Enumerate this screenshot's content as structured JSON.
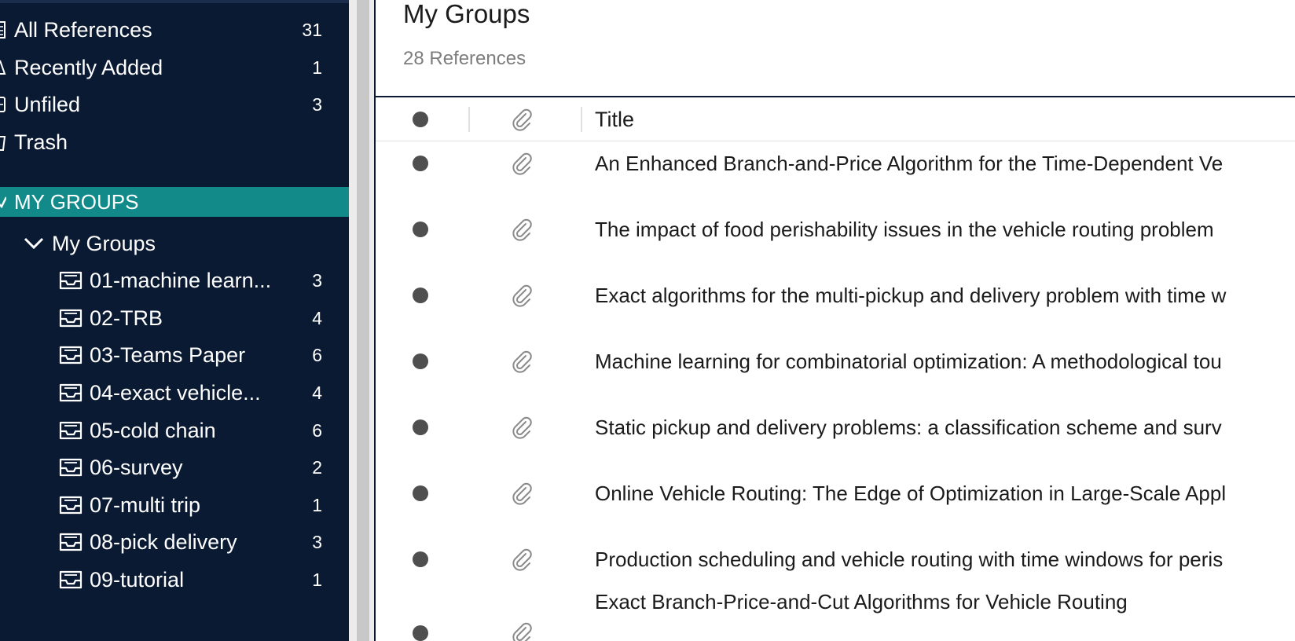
{
  "sidebar": {
    "library": [
      {
        "label": "All References",
        "count": "31",
        "icon": "all-references-icon"
      },
      {
        "label": "Recently Added",
        "count": "1",
        "icon": "recently-added-icon"
      },
      {
        "label": "Unfiled",
        "count": "3",
        "icon": "unfiled-icon"
      },
      {
        "label": "Trash",
        "count": "",
        "icon": "trash-icon"
      }
    ],
    "section_label": "MY GROUPS",
    "group": {
      "label": "My Groups",
      "collections": [
        {
          "label": "01-machine learn...",
          "count": "3"
        },
        {
          "label": "02-TRB",
          "count": "4"
        },
        {
          "label": "03-Teams Paper",
          "count": "6"
        },
        {
          "label": "04-exact vehicle...",
          "count": "4"
        },
        {
          "label": "05-cold chain",
          "count": "6"
        },
        {
          "label": "06-survey",
          "count": "2"
        },
        {
          "label": "07-multi trip",
          "count": "1"
        },
        {
          "label": "08-pick delivery",
          "count": "3"
        },
        {
          "label": "09-tutorial",
          "count": "1"
        }
      ]
    }
  },
  "main": {
    "title": "My Groups",
    "subtitle": "28 References",
    "columns": {
      "title": "Title"
    },
    "rows": [
      "An Enhanced Branch-and-Price Algorithm for the Time-Dependent Ve",
      "The impact of food perishability issues in the vehicle routing problem",
      "Exact algorithms for the multi-pickup and delivery problem with time w",
      "Machine learning for combinatorial optimization: A methodological tou",
      "Static pickup and delivery problems: a classification scheme and surv",
      "Online Vehicle Routing: The Edge of Optimization in Large-Scale Appl",
      "Production scheduling and vehicle routing with time windows for peris",
      "Exact Branch-Price-and-Cut Algorithms for Vehicle Routing"
    ]
  },
  "colors": {
    "sidebar_bg": "#0b1a33",
    "accent": "#138a8a",
    "dot": "#4f4f4f"
  }
}
